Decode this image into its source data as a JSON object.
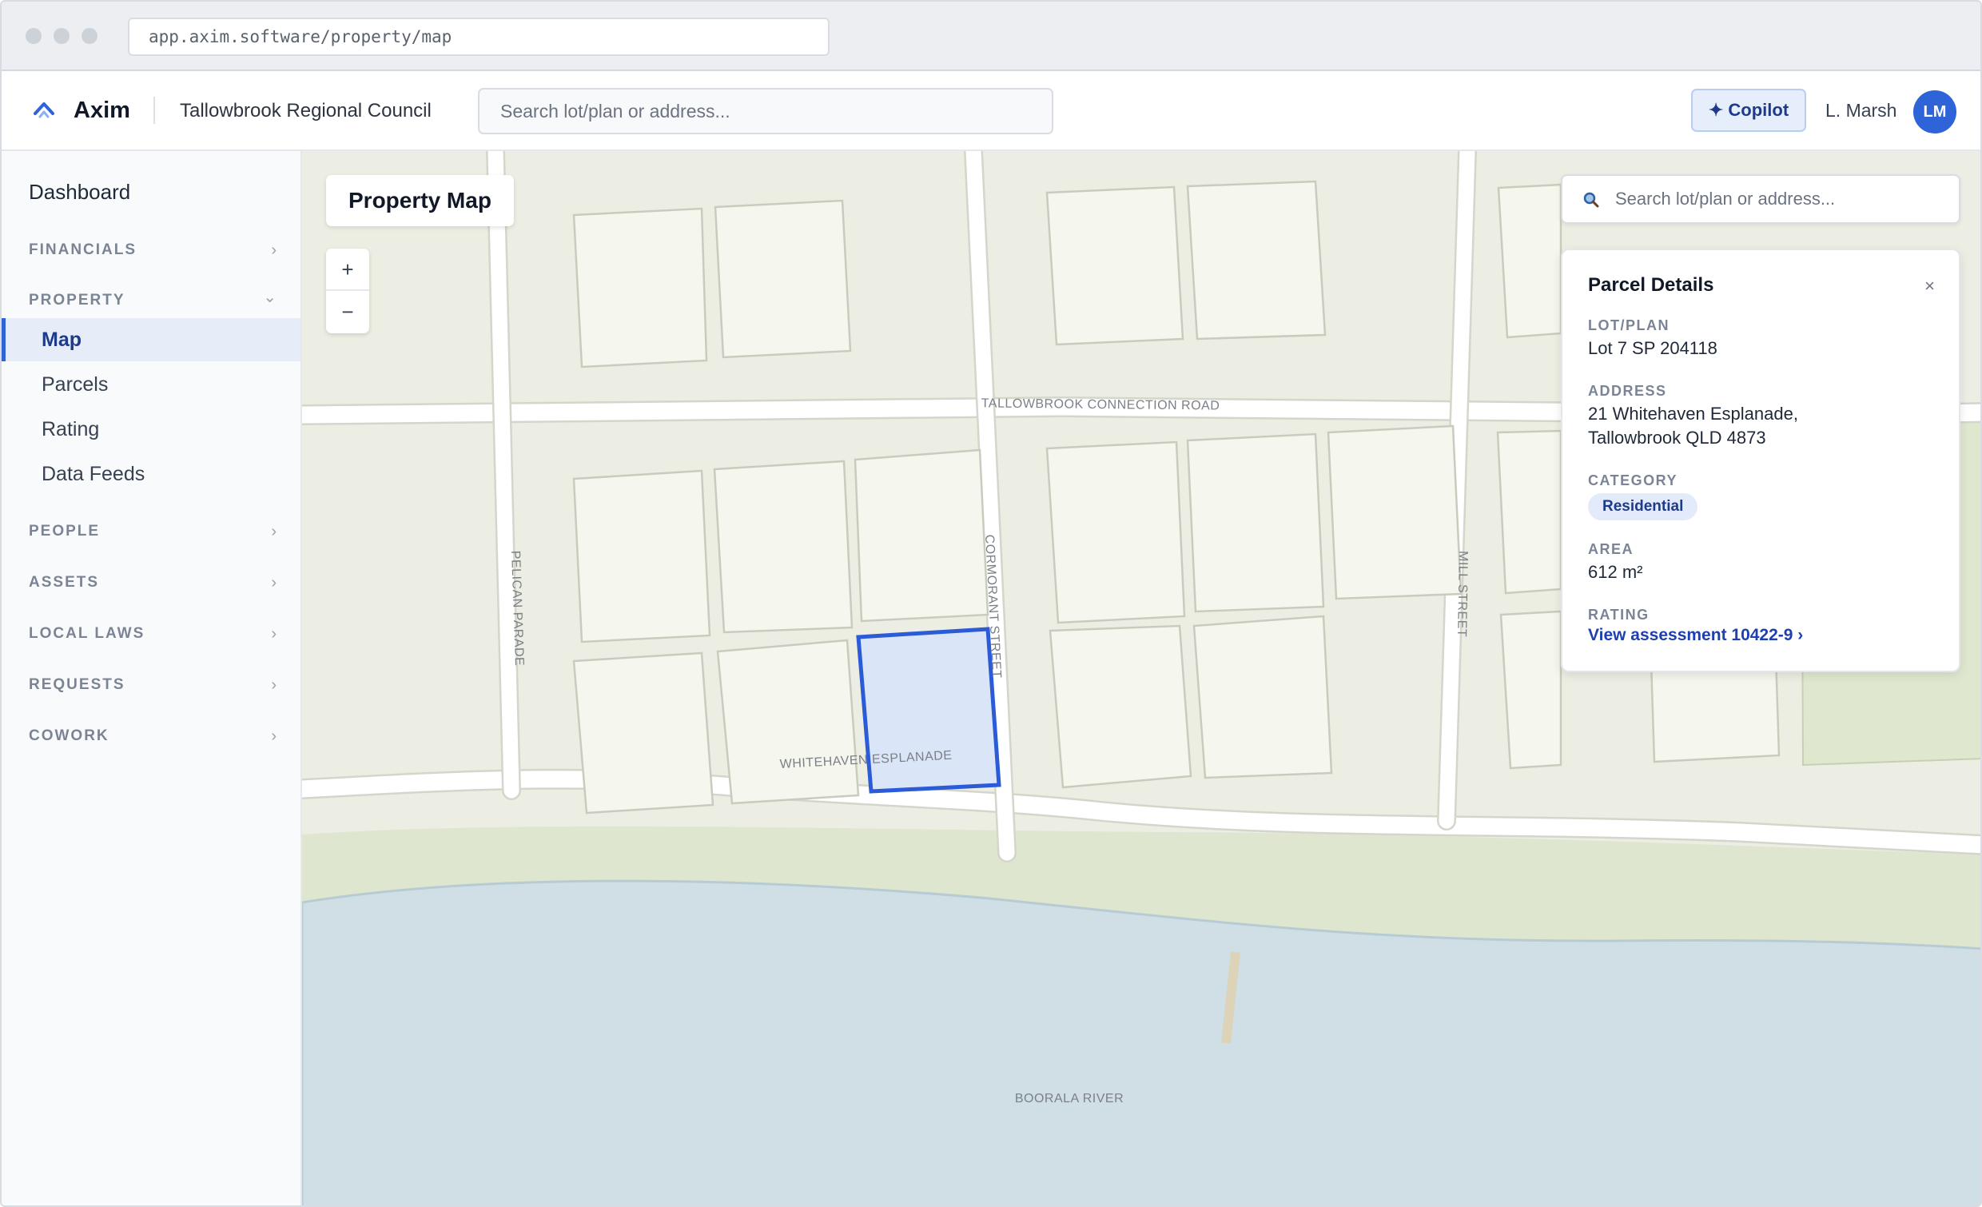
{
  "browser": {
    "url": "app.axim.software/property/map"
  },
  "header": {
    "brand": "Axim",
    "organisation": "Tallowbrook Regional Council",
    "search_placeholder": "Search lot/plan or address...",
    "copilot_label": "✦ Copilot",
    "user_name": "L. Marsh",
    "user_initials": "LM"
  },
  "sidebar": {
    "dashboard": "Dashboard",
    "sections": [
      {
        "label": "FINANCIALS",
        "expanded": false
      },
      {
        "label": "PROPERTY",
        "expanded": true
      },
      {
        "label": "PEOPLE",
        "expanded": false
      },
      {
        "label": "ASSETS",
        "expanded": false
      },
      {
        "label": "LOCAL LAWS",
        "expanded": false
      },
      {
        "label": "REQUESTS",
        "expanded": false
      },
      {
        "label": "COWORK",
        "expanded": false
      }
    ],
    "property_items": [
      "Map",
      "Parcels",
      "Rating",
      "Data Feeds"
    ],
    "active_item": "Map",
    "chevron_collapsed": "›",
    "chevron_expanded": "⌄"
  },
  "map": {
    "title": "Property Map",
    "zoom_in": "+",
    "zoom_out": "−",
    "search_placeholder": "Search lot/plan or address...",
    "labels": {
      "connection_road": "TALLOWBROOK CONNECTION ROAD",
      "pelican": "PELICAN PARADE",
      "cormorant": "CORMORANT STREET",
      "mill": "MILL STREET",
      "esplanade": "WHITEHAVEN ESPLANADE",
      "river": "BOORALA RIVER"
    },
    "colors": {
      "land": "#edeee3",
      "lot_fill": "#f5f6ee",
      "lot_stroke": "#c9ccbc",
      "road": "#ffffff",
      "foreshore": "#dfe6d0",
      "water": "#d0dfe6",
      "selected_fill": "#dae5f7",
      "selected_stroke": "#2b5bd7",
      "park": "#dfe8cf"
    }
  },
  "parcel": {
    "title": "Parcel Details",
    "close": "×",
    "lot_plan_label": "LOT/PLAN",
    "lot_plan": "Lot 7 SP 204118",
    "address_label": "ADDRESS",
    "address_line1": "21 Whitehaven Esplanade,",
    "address_line2": "Tallowbrook QLD 4873",
    "category_label": "CATEGORY",
    "category": "Residential",
    "area_label": "AREA",
    "area": "612 m²",
    "rating_label": "RATING",
    "rating_link": "View assessment 10422-9 ›"
  }
}
